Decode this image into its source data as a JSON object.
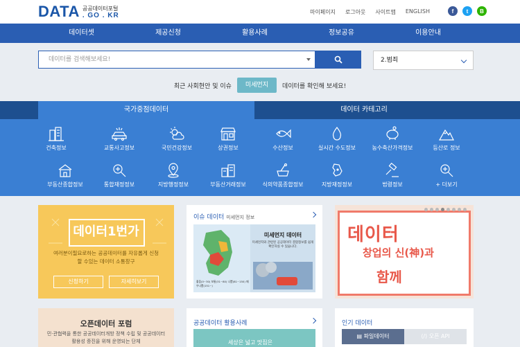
{
  "header": {
    "logo_main": "DATA",
    "logo_kr": "공공데이터포털",
    "logo_domain": ". GO . KR",
    "util_links": [
      "마이페이지",
      "로그아웃",
      "사이트맵",
      "ENGLISH"
    ],
    "sns": [
      {
        "icon": "facebook-icon",
        "glyph": "f",
        "color": "#3b5998"
      },
      {
        "icon": "twitter-icon",
        "glyph": "t",
        "color": "#1da1f2"
      },
      {
        "icon": "blog-icon",
        "glyph": "B",
        "color": "#2db400"
      }
    ]
  },
  "nav": [
    "데이터셋",
    "제공신청",
    "활용사례",
    "정보공유",
    "이용안내"
  ],
  "search": {
    "placeholder": "데이터를 검색해보세요!",
    "scope": "2.범죄"
  },
  "issue": {
    "prefix": "최근 사회현안 및 이슈",
    "keyword": "미세먼지",
    "suffix": "데이터를 확인해 보세요!"
  },
  "category": {
    "tabs": [
      "국가중점데이터",
      "데이터 카테고리"
    ],
    "active_tab": 0,
    "items": [
      {
        "label": "건축정보",
        "icon": "building-icon"
      },
      {
        "label": "교통사고정보",
        "icon": "traffic-accident-icon"
      },
      {
        "label": "국민건강정보",
        "icon": "weather-health-icon"
      },
      {
        "label": "상권정보",
        "icon": "shop-icon"
      },
      {
        "label": "수산정보",
        "icon": "fish-icon"
      },
      {
        "label": "실시간 수도정보",
        "icon": "water-drop-icon"
      },
      {
        "label": "농수축산가격정보",
        "icon": "piggy-bank-icon"
      },
      {
        "label": "등산로 정보",
        "icon": "mountain-icon"
      },
      {
        "label": "부동산종합정보",
        "icon": "house-icon"
      },
      {
        "label": "통합재정정보",
        "icon": "finance-search-icon"
      },
      {
        "label": "지방행정정보",
        "icon": "map-pin-icon"
      },
      {
        "label": "부동산거래정보",
        "icon": "real-estate-icon"
      },
      {
        "label": "식의약품종합정보",
        "icon": "medicine-icon"
      },
      {
        "label": "지방재정정보",
        "icon": "korea-map-icon"
      },
      {
        "label": "법령정보",
        "icon": "gavel-icon"
      },
      {
        "label": "+ 더보기",
        "icon": "more-search-icon"
      }
    ]
  },
  "cards": {
    "contest": {
      "title": "데이터1번가",
      "desc": "여러분이필요로하는 공공데이터를 자유롭게 신청할 수있는 데이터 소통창구",
      "btn_apply": "신청하기",
      "btn_more": "자세히보기"
    },
    "issue_data": {
      "title": "이슈 데이터",
      "subtitle": "미세먼지 정보",
      "panel_title": "미세먼지 데이터",
      "panel_desc": "미세먼지와 관련된 공공데이터 결합정보를 쉽게 확인하실 수 있습니다.",
      "legend": [
        "좋음(0~30)",
        "보통(31~80)",
        "나쁨(81~150)",
        "매우나쁨(151~)"
      ]
    },
    "startup": {
      "line1": "데이터",
      "line2": "창업의 신(神)과",
      "line3": "함께"
    },
    "forum": {
      "title": "오픈데이터 포럼",
      "desc": "민·관협력을 통한 공공데이터개방 정책 수립 및 공공데이터 활용성 증진을 위해 운영되는 단체"
    },
    "usage": {
      "title": "공공데이터 활용사례",
      "banner": "세상은 넓고 맛집은"
    },
    "popular": {
      "title": "인기 데이터",
      "tabs": [
        "파일데이터",
        "오픈 API"
      ]
    }
  }
}
